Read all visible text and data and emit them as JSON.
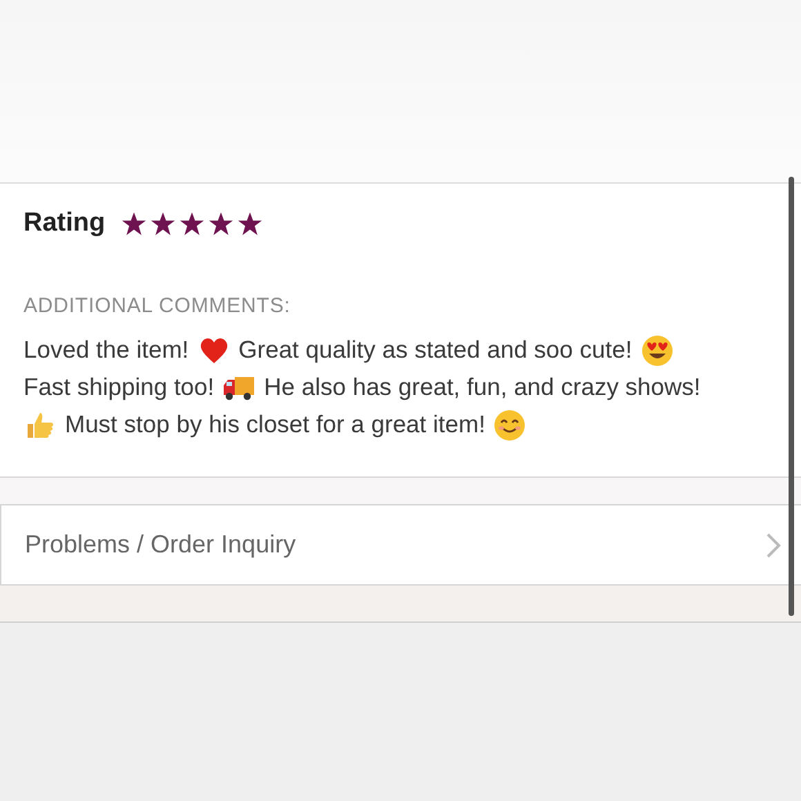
{
  "rating": {
    "label": "Rating",
    "stars": 5
  },
  "comments": {
    "heading": "ADDITIONAL COMMENTS:",
    "lines": [
      [
        {
          "kind": "text",
          "text": "Loved the item!"
        },
        {
          "kind": "heart"
        },
        {
          "kind": "text",
          "text": "Great quality as stated and soo cute!"
        },
        {
          "kind": "heart_eyes"
        }
      ],
      [
        {
          "kind": "text",
          "text": "Fast shipping too!"
        },
        {
          "kind": "truck"
        },
        {
          "kind": "text",
          "text": "He also has great, fun, and crazy shows!"
        }
      ],
      [
        {
          "kind": "thumbs_up"
        },
        {
          "kind": "text",
          "text": "Must stop by his closet for a great item!"
        },
        {
          "kind": "smile"
        }
      ]
    ]
  },
  "inquiry": {
    "label": "Problems / Order Inquiry"
  }
}
